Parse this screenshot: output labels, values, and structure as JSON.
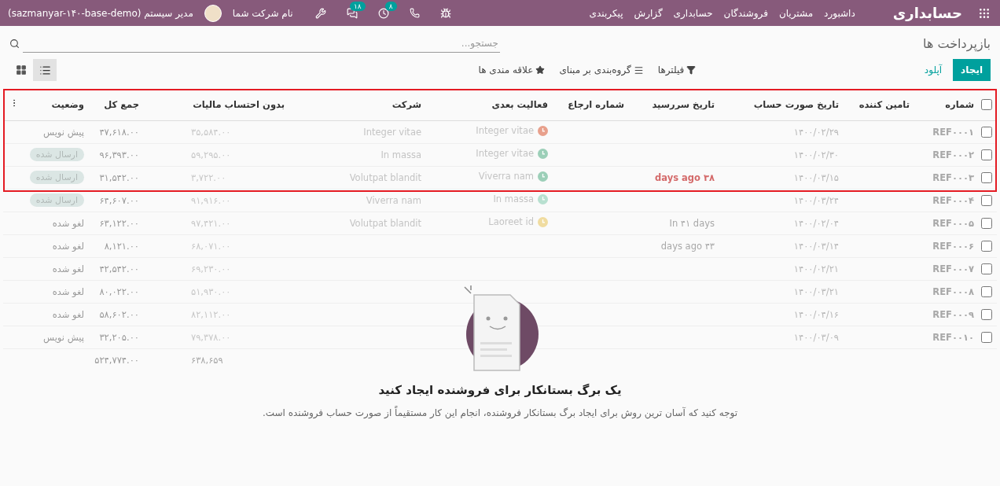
{
  "navbar": {
    "brand": "حسابداری",
    "menu": [
      "داشبورد",
      "مشتریان",
      "فروشندگان",
      "حسابداری",
      "گزارش",
      "پیکربندی"
    ],
    "systray": [
      {
        "kind": "debug"
      },
      {
        "kind": "phone"
      },
      {
        "kind": "activities",
        "count": "۸"
      },
      {
        "kind": "messages",
        "count": "۱۸"
      },
      {
        "kind": "tools"
      }
    ],
    "company": "نام شرکت شما",
    "user": "مدیر سیستم (sazmanyar-۱۴۰-base-demo)"
  },
  "control_panel": {
    "breadcrumb": "بازپرداخت ها",
    "buttons": [
      {
        "label": "ایجاد",
        "primary": true
      },
      {
        "label": "آپلود",
        "primary": false
      }
    ],
    "search": {
      "placeholder": "جستجو..."
    },
    "filters": [
      {
        "kind": "filter",
        "label": "فیلترها"
      },
      {
        "kind": "group",
        "label": "گروه‌بندی بر مبنای"
      },
      {
        "kind": "favorite",
        "label": "علاقه مندی ها"
      }
    ],
    "views": [
      {
        "kind": "list",
        "selected": true
      },
      {
        "kind": "kanban",
        "selected": false
      }
    ]
  },
  "table": {
    "header_checked": false,
    "columns": [
      "شماره",
      "تامین کننده",
      "تاریخ صورت حساب",
      "تاریخ سررسید",
      "شماره ارجاع",
      "فعالیت بعدی",
      "شرکت",
      "بدون احتساب مالیات",
      "جمع کل",
      "وضعیت"
    ],
    "rows": [
      {
        "checked": false,
        "number": "REF۰۰۰۱",
        "date": "۱۴۰۰/۰۲/۲۹",
        "activity": {
          "text": "Integer vitae",
          "color": "#e8a08c"
        },
        "company": "Integer vitae",
        "untaxed": "۳۵,۵۸۴.۰۰",
        "total": "۴۷,۶۱۸.۰۰",
        "status": {
          "kind": "plain",
          "text": "پیش نویس"
        }
      },
      {
        "checked": false,
        "number": "REF۰۰۰۲",
        "date": "۱۴۰۰/۰۲/۳۰",
        "activity": {
          "text": "Integer vitae",
          "color": "#9ccfb8"
        },
        "company": "In massa",
        "untaxed": "۵۹,۲۹۵.۰۰",
        "total": "۹۶,۳۹۳.۰۰",
        "status": {
          "kind": "badge",
          "text": "ارسال شده"
        }
      },
      {
        "checked": false,
        "number": "REF۰۰۰۳",
        "date": "۱۴۰۰/۰۳/۱۵",
        "due": {
          "text": "days ago ۳۸",
          "overdue": true
        },
        "activity": {
          "text": "Viverra nam",
          "color": "#9ccfb8"
        },
        "company": "Volutpat blandit",
        "untaxed": "۳,۷۲۲.۰۰",
        "total": "۳۱,۵۴۲.۰۰",
        "status": {
          "kind": "badge",
          "text": "ارسال شده"
        }
      },
      {
        "checked": false,
        "number": "REF۰۰۰۴",
        "date": "۱۴۰۰/۰۳/۲۴",
        "activity": {
          "text": "In massa",
          "color": "#b8e0d0"
        },
        "company": "Viverra nam",
        "untaxed": "۹۱,۹۱۶.۰۰",
        "total": "۶۴,۶۰۷.۰۰",
        "status": {
          "kind": "badge",
          "text": "ارسال شده"
        }
      },
      {
        "checked": false,
        "number": "REF۰۰۰۵",
        "date": "۱۴۰۰/۰۲/۰۴",
        "due": {
          "text": "In ۴۱ days",
          "overdue": false
        },
        "activity": {
          "text": "Laoreet id",
          "color": "#f0dca0"
        },
        "company": "Volutpat blandit",
        "untaxed": "۹۷,۴۲۱.۰۰",
        "total": "۶۳,۱۲۲.۰۰",
        "status": {
          "kind": "plain",
          "text": "لغو شده"
        }
      },
      {
        "checked": false,
        "number": "REF۰۰۰۶",
        "date": "۱۴۰۰/۰۳/۱۴",
        "due": {
          "text": "days ago ۴۳",
          "overdue": false
        },
        "untaxed": "۶۸,۰۷۱.۰۰",
        "total": "۸,۱۲۱.۰۰",
        "status": {
          "kind": "plain",
          "text": "لغو شده"
        }
      },
      {
        "checked": false,
        "number": "REF۰۰۰۷",
        "date": "۱۴۰۰/۰۲/۲۱",
        "untaxed": "۶۹,۲۳۰.۰۰",
        "total": "۴۲,۵۴۲.۰۰",
        "status": {
          "kind": "plain",
          "text": "لغو شده"
        }
      },
      {
        "checked": false,
        "number": "REF۰۰۰۸",
        "date": "۱۴۰۰/۰۳/۲۱",
        "untaxed": "۵۱,۹۳۰.۰۰",
        "total": "۸۰,۰۲۲.۰۰",
        "status": {
          "kind": "plain",
          "text": "لغو شده"
        }
      },
      {
        "checked": false,
        "number": "REF۰۰۰۹",
        "date": "۱۴۰۰/۰۴/۱۶",
        "untaxed": "۸۲,۱۱۲.۰۰",
        "total": "۵۸,۶۰۲.۰۰",
        "status": {
          "kind": "plain",
          "text": "لغو شده"
        }
      },
      {
        "checked": false,
        "number": "REF۰۰۱۰",
        "date": "۱۴۰۰/۰۳/۰۹",
        "untaxed": "۷۹,۳۷۸.۰۰",
        "total": "۳۲,۲۰۵.۰۰",
        "status": {
          "kind": "plain",
          "text": "پیش نویس"
        }
      }
    ],
    "totals": {
      "untaxed": "۶۳۸,۶۵۹",
      "total": "۵۲۴,۷۷۴.۰۰"
    }
  },
  "annotation": {
    "kind": "frame"
  },
  "helper": {
    "title": "یک برگ بستانکار برای فروشنده ایجاد کنید",
    "text": "توجه کنید که آسان ترین روش برای ایجاد برگ بستانکار فروشنده، انجام این کار مستقیماً از صورت حساب فروشنده است."
  }
}
